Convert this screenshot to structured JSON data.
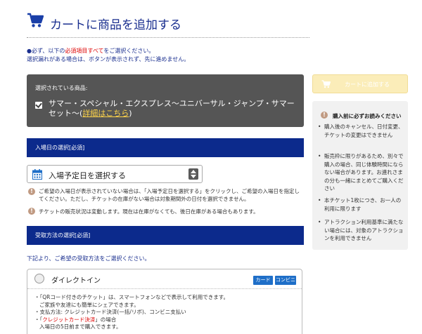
{
  "header": {
    "title": "カートに商品を追加する"
  },
  "notice": {
    "line1_prefix": "●必ず、以下の",
    "line1_red": "必須項目すべて",
    "line1_suffix": "をご選択ください。",
    "line2": "選択漏れがある場合は、ボタンが表示されず、先に進めません。"
  },
  "product": {
    "label": "選択されている商品:",
    "name": "サマー・スペシャル・エクスプレス〜ユニバーサル・ジャンプ・サマーセット〜(",
    "link": "詳細はこちら",
    "close": ")"
  },
  "date_section": {
    "header": "入場日の選択[必須]",
    "select_text": "入場予定日を選択する",
    "warn1": "ご希望の入場日が表示されていない場合は、「入場予定日を選択する」をクリックし、ご希望の入場日を指定してください。ただし、チケットの在庫がない場合は対象期間外の日付を選択できません。",
    "warn2": "チケットの販売状況は変動します。現在は在庫がなくても、後日在庫がある場合もあります。"
  },
  "pickup_section": {
    "header": "受取方法の選択[必須]",
    "intro": "下記より、ご希望の受取方法をご選択ください。",
    "option_title": "ダイレクトイン",
    "badge_card": "カード",
    "badge_conveni": "コンビニ",
    "bullet1": "・「QRコード付きのチケット」は、スマートフォンなどで表示して利用できます。",
    "bullet1b": "ご家族や友達にも簡単にシェアできます。",
    "bullet2": "・支払方法: クレジットカード決済(一括/リボ)、コンビニ支払い",
    "bullet3_prefix": "・「",
    "bullet3_red": "クレジットカード決済",
    "bullet3_suffix": "」の場合",
    "bullet3b": "入場日の5日前まで購入できます。"
  },
  "sidebar": {
    "cart_button": "カートに追加する",
    "info_title": "購入前に必ずお読みください",
    "items": [
      "購入後のキャンセル、日付変更、チケットの変更はできません",
      "販売枠に限りがあるため、別々で購入の場合、同じ体験時間にならない場合があります。お連れさまの分も一緒にまとめてご購入ください",
      "本チケット1枚につき、お一人の利用に限ります",
      "アトラクション利用基準に満たない場合には、対象のアトラクションを利用できません"
    ]
  },
  "colors": {
    "navy": "#0c2a8c",
    "title_blue": "#1a2f8f",
    "required_red": "#dd0000",
    "cart_button_disabled": "#fbedb9",
    "badge_blue": "#1f6fc8"
  },
  "icons": [
    "shopping-cart-icon",
    "calendar-icon",
    "warning-icon",
    "select-arrows-icon"
  ]
}
